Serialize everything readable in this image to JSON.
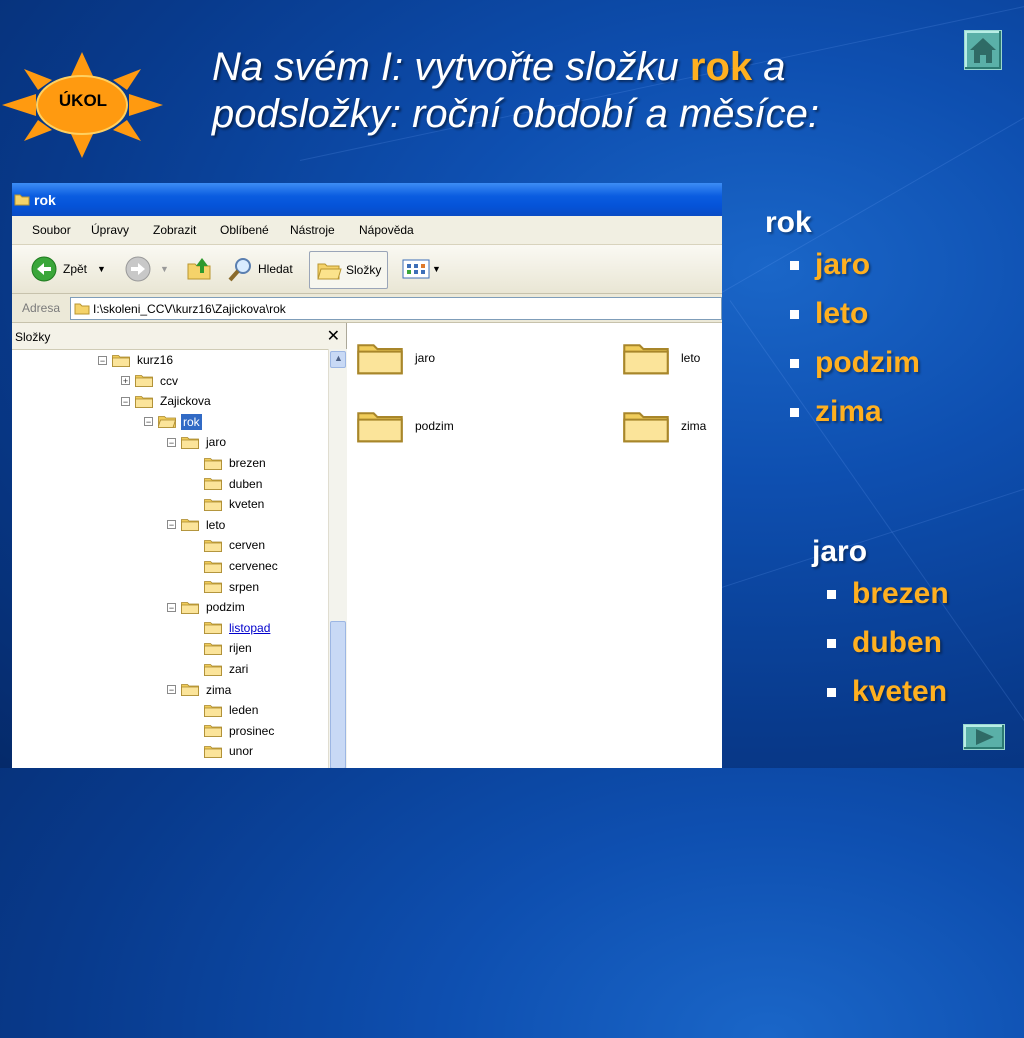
{
  "slide": {
    "title_part1": "Na svém I: vytvořte složku ",
    "title_highlight": "rok",
    "title_part2": " a podsložky: roční období a měsíce:",
    "badge_label": "ÚKOL",
    "accent_color": "#ffb020"
  },
  "window": {
    "title": "rok",
    "menu": [
      "Soubor",
      "Úpravy",
      "Zobrazit",
      "Oblíbené",
      "Nástroje",
      "Nápověda"
    ],
    "toolbar": {
      "back": "Zpět",
      "search": "Hledat",
      "folders": "Složky"
    },
    "address_label": "Adresa",
    "address_value": "I:\\skoleni_CCV\\kurz16\\Zajickova\\rok",
    "tree_header": "Složky",
    "tree": [
      {
        "label": "kurz16",
        "level": 0,
        "expander": "minus"
      },
      {
        "label": "ccv",
        "level": 1,
        "expander": "plus"
      },
      {
        "label": "Zajickova",
        "level": 1,
        "expander": "minus"
      },
      {
        "label": "rok",
        "level": 2,
        "expander": "minus",
        "selected": true,
        "open": true
      },
      {
        "label": "jaro",
        "level": 3,
        "expander": "minus"
      },
      {
        "label": "brezen",
        "level": 4
      },
      {
        "label": "duben",
        "level": 4
      },
      {
        "label": "kveten",
        "level": 4
      },
      {
        "label": "leto",
        "level": 3,
        "expander": "minus"
      },
      {
        "label": "cerven",
        "level": 4
      },
      {
        "label": "cervenec",
        "level": 4
      },
      {
        "label": "srpen",
        "level": 4
      },
      {
        "label": "podzim",
        "level": 3,
        "expander": "minus"
      },
      {
        "label": "listopad",
        "level": 4,
        "link": true
      },
      {
        "label": "rijen",
        "level": 4
      },
      {
        "label": "zari",
        "level": 4
      },
      {
        "label": "zima",
        "level": 3,
        "expander": "minus"
      },
      {
        "label": "leden",
        "level": 4
      },
      {
        "label": "prosinec",
        "level": 4
      },
      {
        "label": "unor",
        "level": 4
      }
    ],
    "content_folders": [
      "jaro",
      "leto",
      "podzim",
      "zima"
    ]
  },
  "list_rok": {
    "title": "rok",
    "items": [
      "jaro",
      "leto",
      "podzim",
      "zima"
    ]
  },
  "list_jaro": {
    "title": "jaro",
    "items": [
      "brezen",
      "duben",
      "kveten"
    ]
  }
}
